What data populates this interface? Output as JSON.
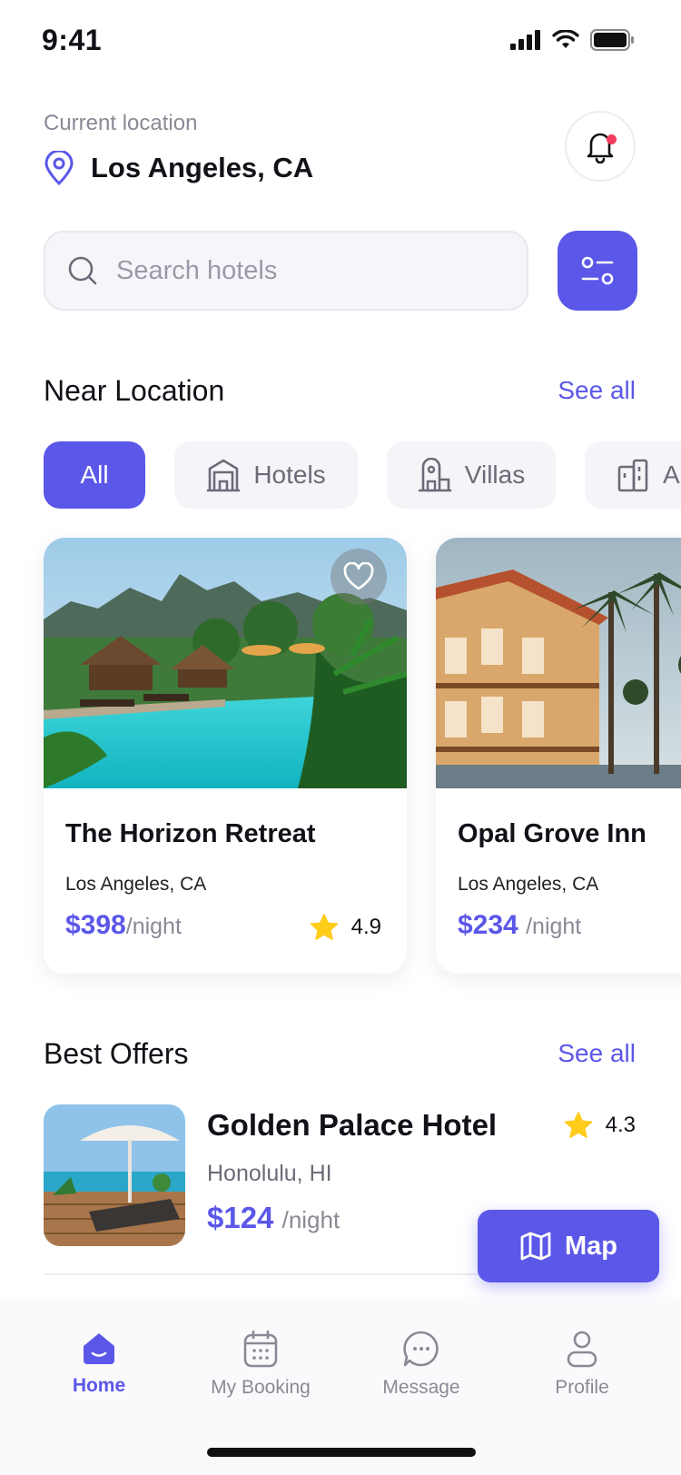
{
  "status_bar": {
    "time": "9:41"
  },
  "location": {
    "label": "Current location",
    "city": "Los Angeles, CA"
  },
  "search": {
    "placeholder": "Search hotels"
  },
  "near": {
    "title": "Near Location",
    "see_all": "See all",
    "chips": [
      {
        "label": "All",
        "active": true,
        "icon": "none"
      },
      {
        "label": "Hotels",
        "active": false,
        "icon": "hotel-icon"
      },
      {
        "label": "Villas",
        "active": false,
        "icon": "villa-icon"
      },
      {
        "label": "Ap",
        "active": false,
        "icon": "apartment-icon"
      }
    ],
    "cards": [
      {
        "name": "The Horizon Retreat",
        "city": "Los Angeles, CA",
        "price": "$398",
        "unit": "/night",
        "rating": "4.9"
      },
      {
        "name": "Opal Grove Inn",
        "city": "Los Angeles, CA",
        "price": "$234",
        "unit": "/night",
        "rating": ""
      }
    ]
  },
  "offers": {
    "title": "Best Offers",
    "see_all": "See all",
    "items": [
      {
        "name": "Golden Palace Hotel",
        "city": "Honolulu, HI",
        "price": "$124",
        "unit": "/night",
        "rating": "4.3"
      }
    ]
  },
  "map_button": {
    "label": "Map"
  },
  "tabs": [
    {
      "label": "Home",
      "active": true
    },
    {
      "label": "My Booking",
      "active": false
    },
    {
      "label": "Message",
      "active": false
    },
    {
      "label": "Profile",
      "active": false
    }
  ],
  "colors": {
    "accent": "#5b57e8",
    "star": "#ffcc1a",
    "notification_dot": "#f23c5d"
  }
}
